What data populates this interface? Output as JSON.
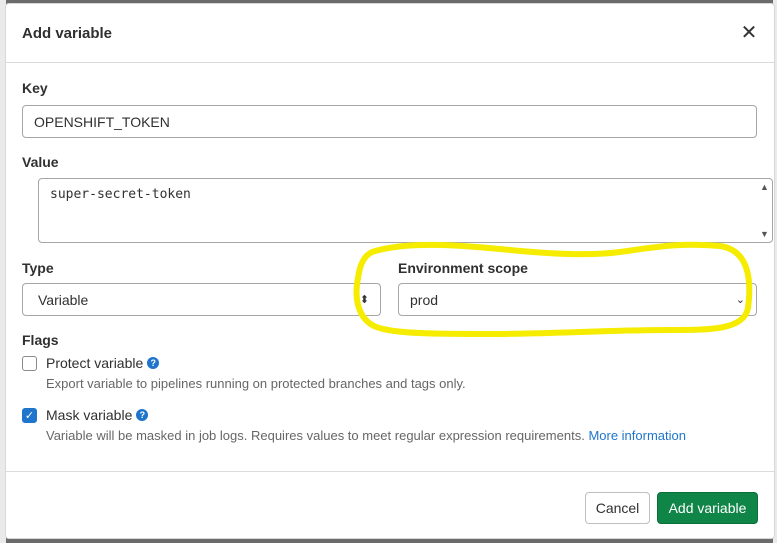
{
  "modal": {
    "title": "Add variable",
    "close_icon": "close-icon"
  },
  "form": {
    "key": {
      "label": "Key",
      "value": "OPENSHIFT_TOKEN"
    },
    "value": {
      "label": "Value",
      "value": "super-secret-token"
    },
    "type": {
      "label": "Type",
      "selected": "Variable"
    },
    "environment_scope": {
      "label": "Environment scope",
      "selected": "prod"
    },
    "flags": {
      "label": "Flags",
      "protect": {
        "label": "Protect variable",
        "checked": false,
        "help": "Export variable to pipelines running on protected branches and tags only."
      },
      "mask": {
        "label": "Mask variable",
        "checked": true,
        "help": "Variable will be masked in job logs. Requires values to meet regular expression requirements.",
        "link": "More information"
      }
    }
  },
  "footer": {
    "cancel_label": "Cancel",
    "submit_label": "Add variable"
  },
  "annotation": {
    "color": "#f5ec00",
    "target": "environment-scope"
  },
  "colors": {
    "primary": "#108548",
    "accent": "#1f75cb"
  }
}
